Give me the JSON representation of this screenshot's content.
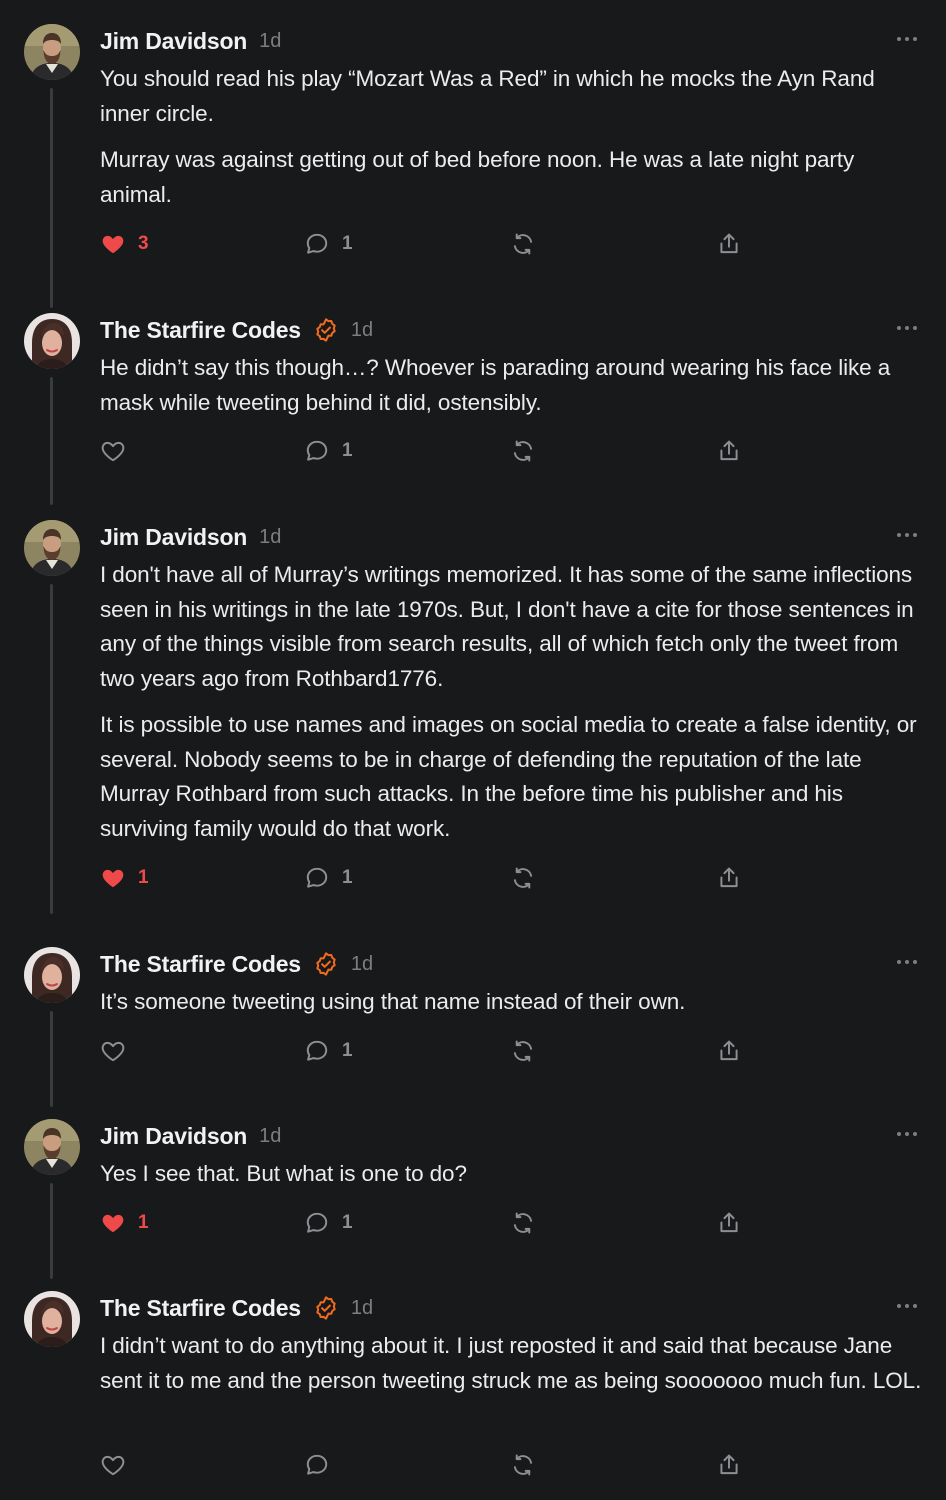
{
  "colors": {
    "background": "#18191b",
    "text": "#ececec",
    "muted": "#7d7e82",
    "like_active": "#ef4a4a",
    "verified": "#f06a1f",
    "thread_line": "#3a3b3d"
  },
  "posts": [
    {
      "author": "Jim Davidson",
      "time": "1d",
      "verified": false,
      "avatar": "jim",
      "paragraphs": [
        "You should read his play “Mozart Was a Red” in which he mocks the Ayn Rand inner circle.",
        "Murray was against getting out of bed before noon. He was a late night party animal."
      ],
      "liked": true,
      "likes": "3",
      "comments": "1"
    },
    {
      "author": "The Starfire Codes",
      "time": "1d",
      "verified": true,
      "avatar": "starfire",
      "paragraphs": [
        "He didn’t say this though…? Whoever is parading around wearing his face like a mask while tweeting behind it did, ostensibly."
      ],
      "liked": false,
      "likes": "",
      "comments": "1"
    },
    {
      "author": "Jim Davidson",
      "time": "1d",
      "verified": false,
      "avatar": "jim",
      "paragraphs": [
        "I don't have all of Murray’s writings memorized. It has some of the same inflections seen in his writings in the late 1970s. But, I don't have a cite for those sentences in any of the things visible from search results, all of which fetch only the tweet from two years ago from Rothbard1776.",
        "It is possible to use names and images on social media to create a false identity, or several. Nobody seems to be in charge of defending the reputation of the late Murray Rothbard from such attacks. In the before time his publisher and his surviving family would do that work."
      ],
      "liked": true,
      "likes": "1",
      "comments": "1"
    },
    {
      "author": "The Starfire Codes",
      "time": "1d",
      "verified": true,
      "avatar": "starfire",
      "paragraphs": [
        "It’s someone tweeting using that name instead of their own."
      ],
      "liked": false,
      "likes": "",
      "comments": "1"
    },
    {
      "author": "Jim Davidson",
      "time": "1d",
      "verified": false,
      "avatar": "jim",
      "paragraphs": [
        "Yes I see that. But what is one to do?"
      ],
      "liked": true,
      "likes": "1",
      "comments": "1"
    },
    {
      "author": "The Starfire Codes",
      "time": "1d",
      "verified": true,
      "avatar": "starfire",
      "paragraphs": [
        "I didn’t want to do anything about it. I just reposted it and said that because Jane sent it to me and the person tweeting struck me as being sooooooo much fun. LOL."
      ],
      "liked": false,
      "likes": "",
      "comments": ""
    }
  ]
}
